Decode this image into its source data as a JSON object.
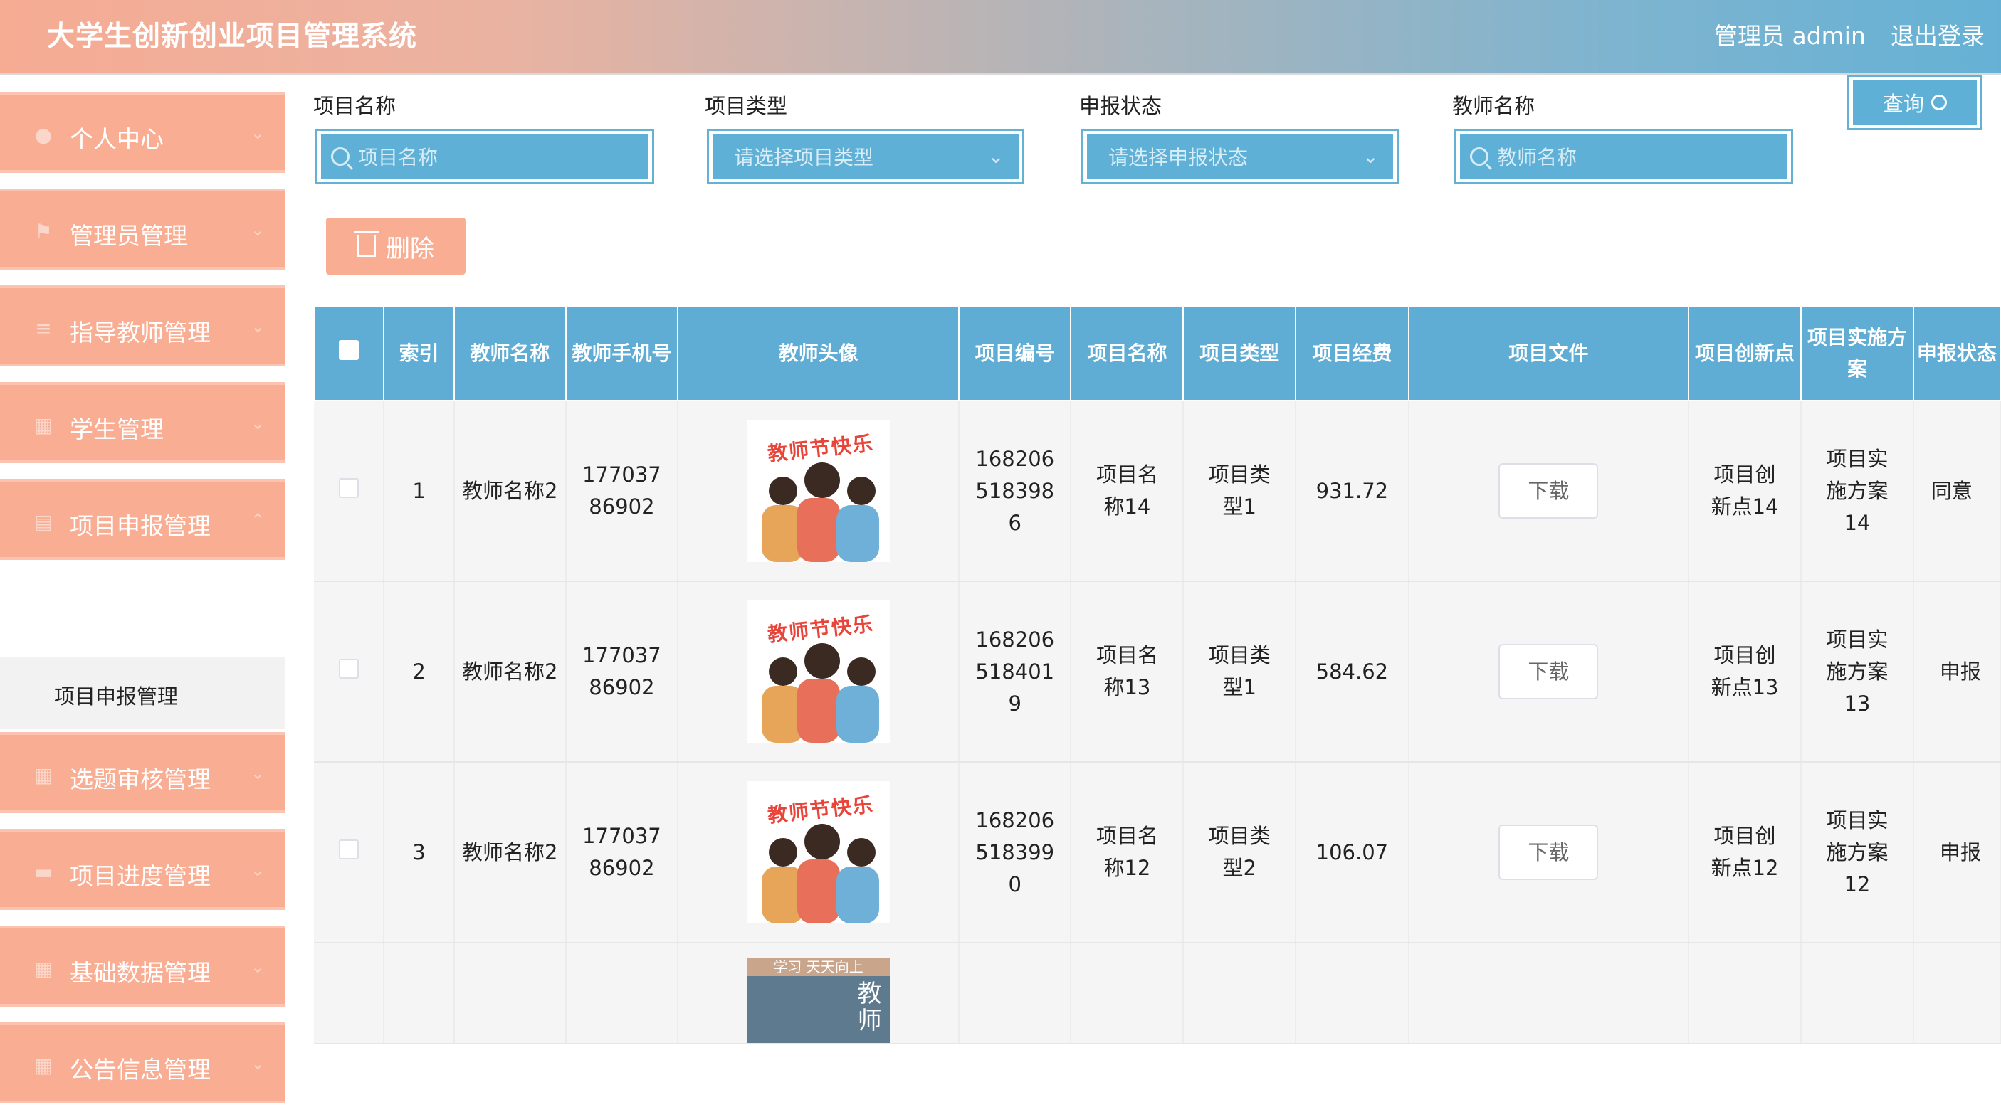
{
  "header": {
    "title": "大学生创新创业项目管理系统",
    "user": "管理员 admin",
    "logout": "退出登录"
  },
  "sidebar": {
    "items": [
      {
        "label": "个人中心",
        "icon": "user-icon"
      },
      {
        "label": "管理员管理",
        "icon": "flag-icon"
      },
      {
        "label": "指导教师管理",
        "icon": "list-icon"
      },
      {
        "label": "学生管理",
        "icon": "grid-icon"
      },
      {
        "label": "项目申报管理",
        "icon": "doc-icon"
      },
      {
        "label": "选题审核管理",
        "icon": "grid-icon"
      },
      {
        "label": "项目进度管理",
        "icon": "chat-icon"
      },
      {
        "label": "基础数据管理",
        "icon": "grid-icon"
      },
      {
        "label": "公告信息管理",
        "icon": "grid-icon"
      }
    ],
    "active_sub": "项目申报管理"
  },
  "filters": {
    "name": {
      "label": "项目名称",
      "placeholder": "项目名称"
    },
    "type": {
      "label": "项目类型",
      "placeholder": "请选择项目类型"
    },
    "status": {
      "label": "申报状态",
      "placeholder": "请选择申报状态"
    },
    "teacher": {
      "label": "教师名称",
      "placeholder": "教师名称"
    },
    "query": "查询"
  },
  "actions": {
    "delete": "删除"
  },
  "table": {
    "headers": [
      "索引",
      "教师名称",
      "教师手机号",
      "教师头像",
      "项目编号",
      "项目名称",
      "项目类型",
      "项目经费",
      "项目文件",
      "项目创新点",
      "项目实施方案",
      "申报状态"
    ],
    "avatar_caption": "教师节快乐",
    "avatar2_banner": "学习  天天向上",
    "avatar2_text": "教师",
    "download": "下载",
    "rows": [
      {
        "index": "1",
        "teacher": "教师名称2",
        "phone": "17703786902",
        "code": "1682065183986",
        "name": "项目名称14",
        "type": "项目类型1",
        "fund": "931.72",
        "innov": "项目创新点14",
        "plan": "项目实施方案14",
        "status": "同意"
      },
      {
        "index": "2",
        "teacher": "教师名称2",
        "phone": "17703786902",
        "code": "1682065184019",
        "name": "项目名称13",
        "type": "项目类型1",
        "fund": "584.62",
        "innov": "项目创新点13",
        "plan": "项目实施方案13",
        "status": "申报"
      },
      {
        "index": "3",
        "teacher": "教师名称2",
        "phone": "17703786902",
        "code": "1682065183990",
        "name": "项目名称12",
        "type": "项目类型2",
        "fund": "106.07",
        "innov": "项目创新点12",
        "plan": "项目实施方案12",
        "status": "申报"
      }
    ]
  }
}
